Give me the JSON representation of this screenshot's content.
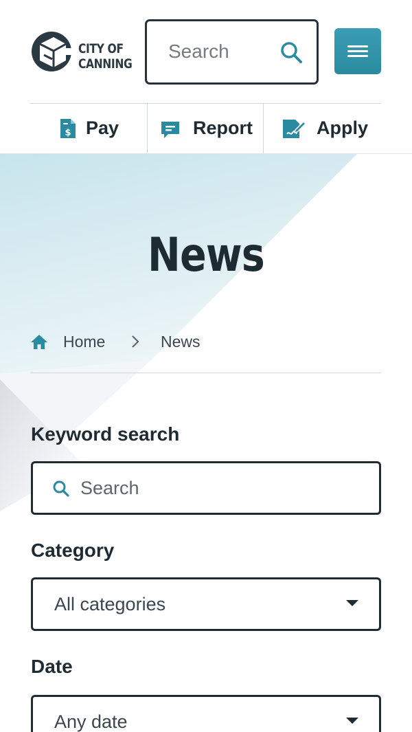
{
  "brand": {
    "line1": "CITY OF",
    "line2": "CANNING"
  },
  "header": {
    "search_placeholder": "Search"
  },
  "quick_links": [
    {
      "label": "Pay",
      "icon": "pay-icon"
    },
    {
      "label": "Report",
      "icon": "report-icon"
    },
    {
      "label": "Apply",
      "icon": "apply-icon"
    }
  ],
  "page": {
    "title": "News"
  },
  "breadcrumb": {
    "home": "Home",
    "current": "News"
  },
  "filters": {
    "keyword": {
      "label": "Keyword search",
      "placeholder": "Search"
    },
    "category": {
      "label": "Category",
      "value": "All categories"
    },
    "date": {
      "label": "Date",
      "value": "Any date"
    }
  },
  "colors": {
    "accent": "#2a8aa0",
    "text": "#1f2b33",
    "hero_tint": "#cfe7ee"
  }
}
